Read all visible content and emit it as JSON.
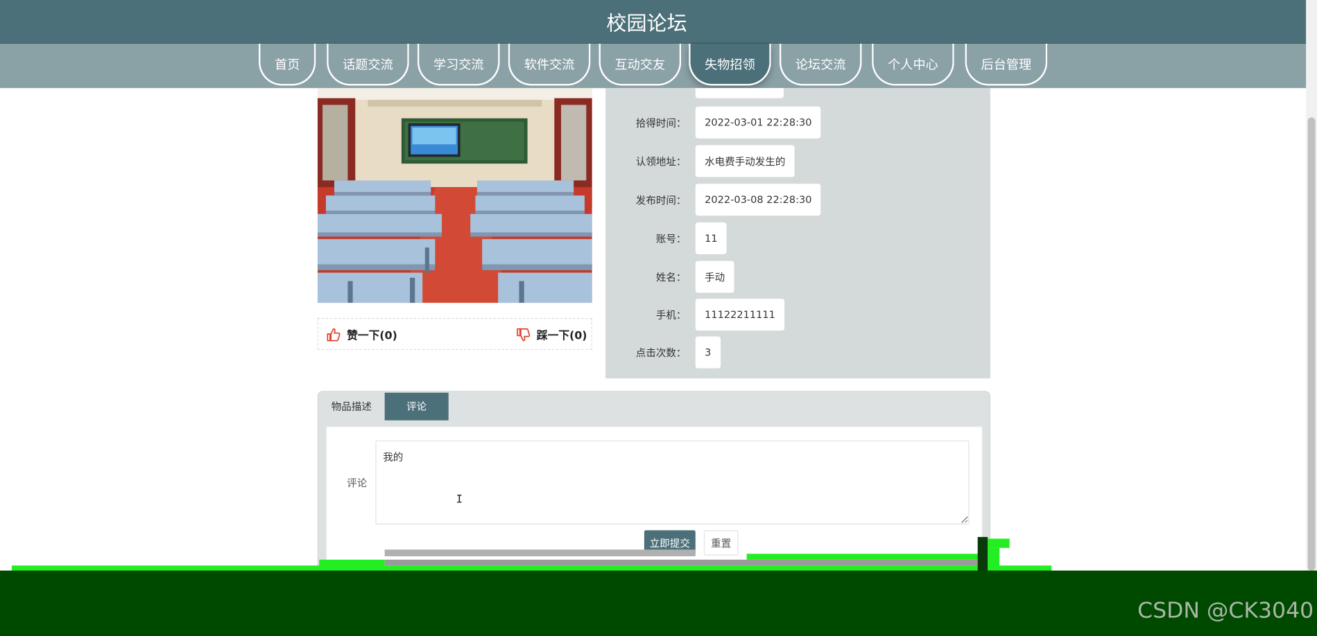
{
  "site": {
    "title": "校园论坛"
  },
  "nav": {
    "items": [
      {
        "label": "首页"
      },
      {
        "label": "话题交流"
      },
      {
        "label": "学习交流"
      },
      {
        "label": "软件交流"
      },
      {
        "label": "互动交友"
      },
      {
        "label": "失物招领",
        "active": true
      },
      {
        "label": "论坛交流"
      },
      {
        "label": "个人中心"
      },
      {
        "label": "后台管理"
      }
    ]
  },
  "votes": {
    "like": "赞一下(0)",
    "dislike": "踩一下(0)"
  },
  "details": {
    "rows": [
      {
        "label": "拾得时间：",
        "value": "2022-03-01 22:28:30"
      },
      {
        "label": "认领地址：",
        "value": "水电费手动发生的"
      },
      {
        "label": "发布时间：",
        "value": "2022-03-08 22:28:30"
      },
      {
        "label": "账号：",
        "value": "11"
      },
      {
        "label": "姓名：",
        "value": "手动"
      },
      {
        "label": "手机：",
        "value": "11122211111"
      },
      {
        "label": "点击次数：",
        "value": "3"
      }
    ]
  },
  "tabs": {
    "description": "物品描述",
    "comment": "评论"
  },
  "comment_form": {
    "label": "评论",
    "value": "我的",
    "submit": "立即提交",
    "reset": "重置"
  },
  "watermark": "CSDN @CK3040"
}
